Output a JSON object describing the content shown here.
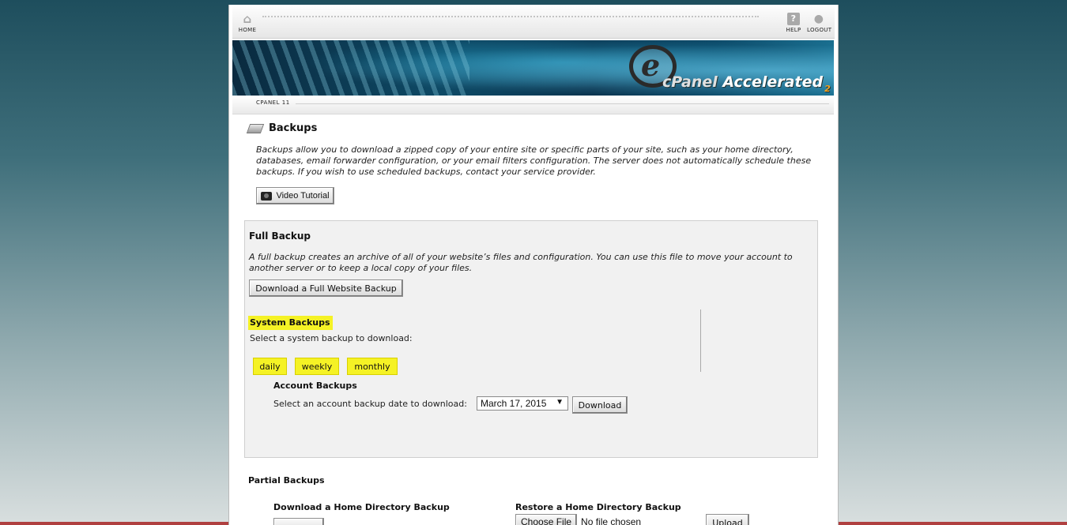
{
  "nav": {
    "home_label": "HOME",
    "help_label": "HELP",
    "logout_label": "LOGOUT",
    "home_icon": "house-icon",
    "help_icon": "question-icon",
    "logout_icon": "user-icon"
  },
  "banner": {
    "logo_mark": "e",
    "brand_prefix": "cPanel",
    "brand_name": "Accelerated",
    "brand_suffix": "2"
  },
  "version_label": "CPANEL 11",
  "page": {
    "title": "Backups",
    "intro": "Backups allow you to download a zipped copy of your entire site or specific parts of your site, such as your home directory, databases, email forwarder configuration, or your email filters configuration. The server does not automatically schedule these backups. If you wish to use scheduled backups, contact your service provider.",
    "video_tutorial_label": "Video Tutorial"
  },
  "full_backup": {
    "title": "Full Backup",
    "description": "A full backup creates an archive of all of your website’s files and configuration. You can use this file to move your account to another server or to keep a local copy of your files.",
    "button_label": "Download a Full Website Backup"
  },
  "system_backups": {
    "title": "System Backups",
    "description": "Select a system backup to download:",
    "buttons": [
      "daily",
      "weekly",
      "monthly"
    ]
  },
  "account_backups": {
    "title": "Account Backups",
    "label": "Select an account backup date to download:",
    "selected_date": "March 17, 2015",
    "download_label": "Download"
  },
  "partial_backups": {
    "title": "Partial Backups",
    "home_dir_title": "Download a Home Directory Backup",
    "restore_title": "Restore a Home Directory Backup",
    "choose_file_label": "Choose File",
    "no_file_text": "No file chosen",
    "upload_label": "Upload"
  },
  "colors": {
    "highlight": "#f5f225",
    "background_top": "#1e4e5d",
    "panel_bg": "#f1f1f1"
  }
}
